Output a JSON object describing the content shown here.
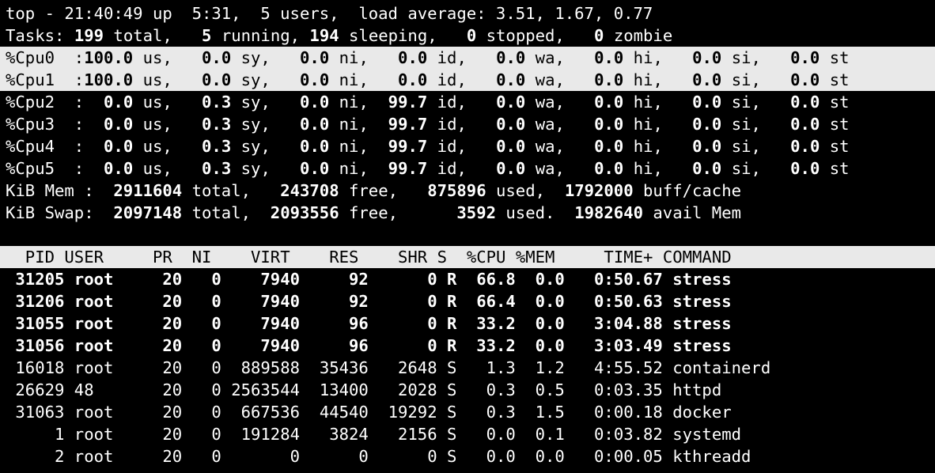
{
  "summary": {
    "line1": "top - 21:40:49 up  5:31,  5 users,  load average: 3.51, 1.67, 0.77",
    "tasks": {
      "label": "Tasks:",
      "total": "199",
      "running": "5",
      "sleeping": "194",
      "stopped": "0",
      "zombie": "0"
    }
  },
  "cpus": [
    {
      "name": "%Cpu0",
      "us": "100.0",
      "sy": "0.0",
      "ni": "0.0",
      "id": "0.0",
      "wa": "0.0",
      "hi": "0.0",
      "si": "0.0",
      "st": "0.0",
      "highlight": true
    },
    {
      "name": "%Cpu1",
      "us": "100.0",
      "sy": "0.0",
      "ni": "0.0",
      "id": "0.0",
      "wa": "0.0",
      "hi": "0.0",
      "si": "0.0",
      "st": "0.0",
      "highlight": true
    },
    {
      "name": "%Cpu2",
      "us": "0.0",
      "sy": "0.3",
      "ni": "0.0",
      "id": "99.7",
      "wa": "0.0",
      "hi": "0.0",
      "si": "0.0",
      "st": "0.0",
      "highlight": false
    },
    {
      "name": "%Cpu3",
      "us": "0.0",
      "sy": "0.3",
      "ni": "0.0",
      "id": "99.7",
      "wa": "0.0",
      "hi": "0.0",
      "si": "0.0",
      "st": "0.0",
      "highlight": false
    },
    {
      "name": "%Cpu4",
      "us": "0.0",
      "sy": "0.3",
      "ni": "0.0",
      "id": "99.7",
      "wa": "0.0",
      "hi": "0.0",
      "si": "0.0",
      "st": "0.0",
      "highlight": false
    },
    {
      "name": "%Cpu5",
      "us": "0.0",
      "sy": "0.3",
      "ni": "0.0",
      "id": "99.7",
      "wa": "0.0",
      "hi": "0.0",
      "si": "0.0",
      "st": "0.0",
      "highlight": false
    }
  ],
  "mem": {
    "label": "KiB Mem :",
    "total": "2911604",
    "free": "243708",
    "used": "875896",
    "buff_cache": "1792000"
  },
  "swap": {
    "label": "KiB Swap:",
    "total": "2097148",
    "free": "2093556",
    "used": "3592",
    "avail": "1982640"
  },
  "columns": [
    "PID",
    "USER",
    "PR",
    "NI",
    "VIRT",
    "RES",
    "SHR",
    "S",
    "%CPU",
    "%MEM",
    "TIME+",
    "COMMAND"
  ],
  "processes": [
    {
      "pid": "31205",
      "user": "root",
      "pr": "20",
      "ni": "0",
      "virt": "7940",
      "res": "92",
      "shr": "0",
      "s": "R",
      "cpu": "66.8",
      "mem": "0.0",
      "time": "0:50.67",
      "cmd": "stress",
      "bold": true
    },
    {
      "pid": "31206",
      "user": "root",
      "pr": "20",
      "ni": "0",
      "virt": "7940",
      "res": "92",
      "shr": "0",
      "s": "R",
      "cpu": "66.4",
      "mem": "0.0",
      "time": "0:50.63",
      "cmd": "stress",
      "bold": true
    },
    {
      "pid": "31055",
      "user": "root",
      "pr": "20",
      "ni": "0",
      "virt": "7940",
      "res": "96",
      "shr": "0",
      "s": "R",
      "cpu": "33.2",
      "mem": "0.0",
      "time": "3:04.88",
      "cmd": "stress",
      "bold": true
    },
    {
      "pid": "31056",
      "user": "root",
      "pr": "20",
      "ni": "0",
      "virt": "7940",
      "res": "96",
      "shr": "0",
      "s": "R",
      "cpu": "33.2",
      "mem": "0.0",
      "time": "3:03.49",
      "cmd": "stress",
      "bold": true
    },
    {
      "pid": "16018",
      "user": "root",
      "pr": "20",
      "ni": "0",
      "virt": "889588",
      "res": "35436",
      "shr": "2648",
      "s": "S",
      "cpu": "1.3",
      "mem": "1.2",
      "time": "4:55.52",
      "cmd": "containerd",
      "bold": false
    },
    {
      "pid": "26629",
      "user": "48",
      "pr": "20",
      "ni": "0",
      "virt": "2563544",
      "res": "13400",
      "shr": "2028",
      "s": "S",
      "cpu": "0.3",
      "mem": "0.5",
      "time": "0:03.35",
      "cmd": "httpd",
      "bold": false
    },
    {
      "pid": "31063",
      "user": "root",
      "pr": "20",
      "ni": "0",
      "virt": "667536",
      "res": "44540",
      "shr": "19292",
      "s": "S",
      "cpu": "0.3",
      "mem": "1.5",
      "time": "0:00.18",
      "cmd": "docker",
      "bold": false
    },
    {
      "pid": "1",
      "user": "root",
      "pr": "20",
      "ni": "0",
      "virt": "191284",
      "res": "3824",
      "shr": "2156",
      "s": "S",
      "cpu": "0.0",
      "mem": "0.1",
      "time": "0:03.82",
      "cmd": "systemd",
      "bold": false
    },
    {
      "pid": "2",
      "user": "root",
      "pr": "20",
      "ni": "0",
      "virt": "0",
      "res": "0",
      "shr": "0",
      "s": "S",
      "cpu": "0.0",
      "mem": "0.0",
      "time": "0:00.05",
      "cmd": "kthreadd",
      "bold": false
    }
  ],
  "colors": {
    "background": "#000000",
    "foreground": "#ffffff",
    "highlight_bg": "#e9e9e9",
    "highlight_fg": "#000000"
  }
}
